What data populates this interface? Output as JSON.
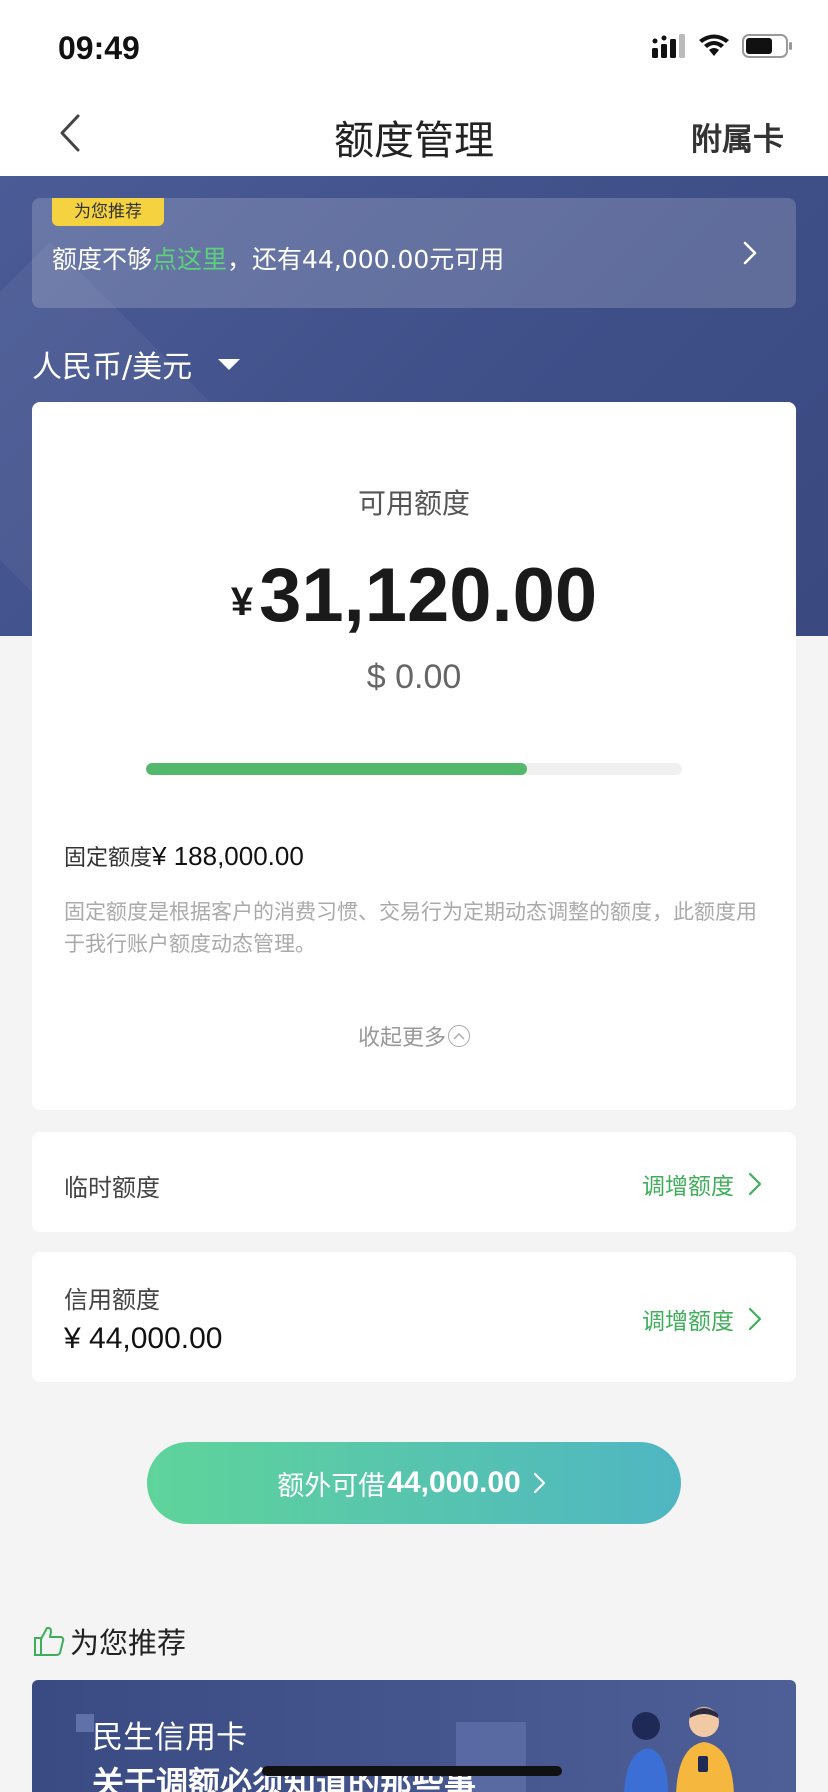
{
  "status": {
    "time": "09:49"
  },
  "nav": {
    "title": "额度管理",
    "right": "附属卡"
  },
  "promo": {
    "tag": "为您推荐",
    "text_prefix": "额度不够",
    "text_highlight": "点这里",
    "text_suffix": "，还有44,000.00元可用"
  },
  "currency": {
    "selected": "人民币/美元"
  },
  "available": {
    "label": "可用额度",
    "currency_symbol": "¥",
    "amount": "31,120.00",
    "usd": "$ 0.00",
    "used_fraction": 0.71
  },
  "fixed": {
    "label": "固定额度",
    "value": "¥ 188,000.00",
    "description": "固定额度是根据客户的消费习惯、交易行为定期动态调整的额度，此额度用于我行账户额度动态管理。",
    "collapse": "收起更多"
  },
  "temp_limit": {
    "label": "临时额度",
    "action": "调增额度"
  },
  "credit_limit": {
    "label": "信用额度",
    "value": "¥ 44,000.00",
    "action": "调增额度"
  },
  "borrow": {
    "label": "额外可借",
    "amount": "44,000.00"
  },
  "recommend": {
    "title": "为您推荐",
    "banner_brand": "民生信用卡",
    "banner_headline": "关于调额必须知道的那些事"
  },
  "colors": {
    "accent_green": "#3fae5a",
    "hero_blue": "#435391",
    "tag_yellow": "#f5d23f"
  }
}
